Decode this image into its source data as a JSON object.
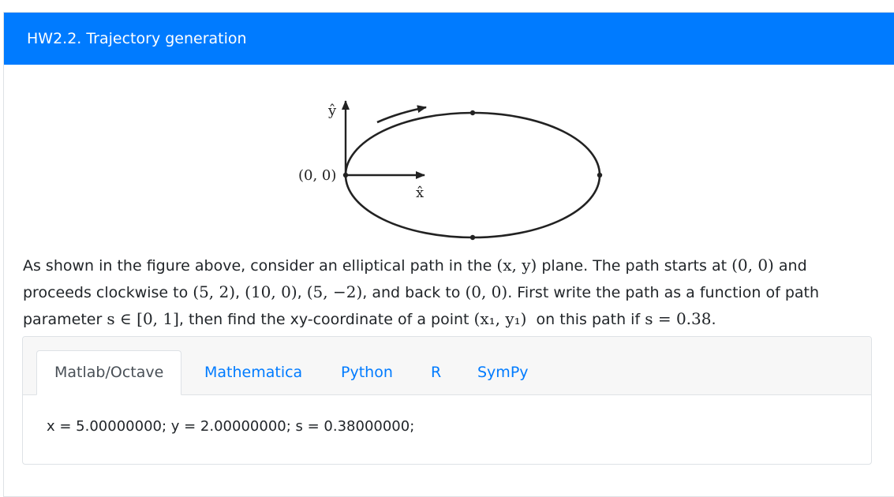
{
  "header": {
    "title": "HW2.2. Trajectory generation"
  },
  "figure": {
    "y_axis_label": "ŷ",
    "x_axis_label": "x̂",
    "origin_label": "(0, 0)"
  },
  "question": {
    "p1": "As shown in the figure above, consider an elliptical path in the ",
    "m1": "(x, y)",
    "p2": " plane. The path starts at ",
    "m2": "(0, 0)",
    "p3": " and proceeds clockwise to ",
    "m3": "(5, 2)",
    "p4": ", ",
    "m4": "(10, 0)",
    "p5": ", ",
    "m5": "(5, −2)",
    "p6": ", and back to ",
    "m6": "(0, 0)",
    "p7": ". First write the path as a function of path parameter ",
    "m7": "s ∈ [0, 1]",
    "p8": ", then find the xy-coordinate of a point ",
    "m8": "(x₁, y₁)",
    "p9": "  on this path if ",
    "m9": "s = 0.38",
    "p10": "."
  },
  "tabs": [
    {
      "label": "Matlab/Octave",
      "active": true
    },
    {
      "label": "Mathematica",
      "active": false
    },
    {
      "label": "Python",
      "active": false
    },
    {
      "label": "R",
      "active": false
    },
    {
      "label": "SymPy",
      "active": false
    }
  ],
  "tab_content": {
    "code": "x = 5.00000000; y = 2.00000000; s = 0.38000000;"
  },
  "colors": {
    "header_bg": "#007bff",
    "link": "#007bff"
  }
}
